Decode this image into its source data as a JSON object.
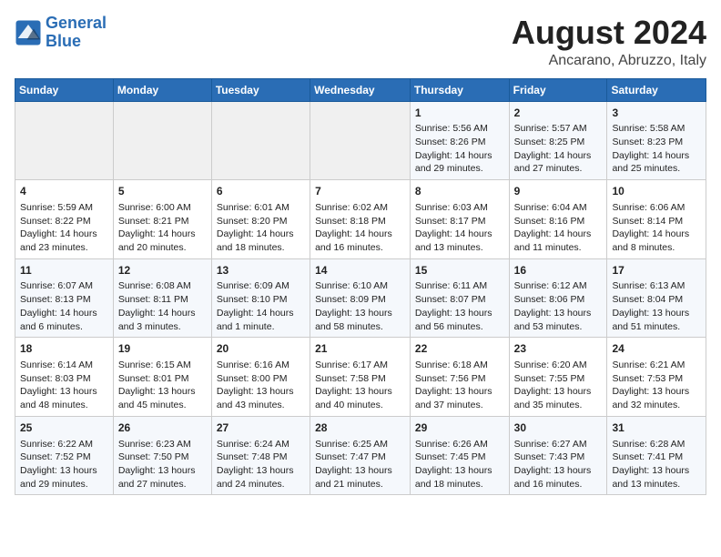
{
  "logo": {
    "line1": "General",
    "line2": "Blue"
  },
  "title": "August 2024",
  "location": "Ancarano, Abruzzo, Italy",
  "days_of_week": [
    "Sunday",
    "Monday",
    "Tuesday",
    "Wednesday",
    "Thursday",
    "Friday",
    "Saturday"
  ],
  "weeks": [
    [
      {
        "day": "",
        "detail": ""
      },
      {
        "day": "",
        "detail": ""
      },
      {
        "day": "",
        "detail": ""
      },
      {
        "day": "",
        "detail": ""
      },
      {
        "day": "1",
        "detail": "Sunrise: 5:56 AM\nSunset: 8:26 PM\nDaylight: 14 hours\nand 29 minutes."
      },
      {
        "day": "2",
        "detail": "Sunrise: 5:57 AM\nSunset: 8:25 PM\nDaylight: 14 hours\nand 27 minutes."
      },
      {
        "day": "3",
        "detail": "Sunrise: 5:58 AM\nSunset: 8:23 PM\nDaylight: 14 hours\nand 25 minutes."
      }
    ],
    [
      {
        "day": "4",
        "detail": "Sunrise: 5:59 AM\nSunset: 8:22 PM\nDaylight: 14 hours\nand 23 minutes."
      },
      {
        "day": "5",
        "detail": "Sunrise: 6:00 AM\nSunset: 8:21 PM\nDaylight: 14 hours\nand 20 minutes."
      },
      {
        "day": "6",
        "detail": "Sunrise: 6:01 AM\nSunset: 8:20 PM\nDaylight: 14 hours\nand 18 minutes."
      },
      {
        "day": "7",
        "detail": "Sunrise: 6:02 AM\nSunset: 8:18 PM\nDaylight: 14 hours\nand 16 minutes."
      },
      {
        "day": "8",
        "detail": "Sunrise: 6:03 AM\nSunset: 8:17 PM\nDaylight: 14 hours\nand 13 minutes."
      },
      {
        "day": "9",
        "detail": "Sunrise: 6:04 AM\nSunset: 8:16 PM\nDaylight: 14 hours\nand 11 minutes."
      },
      {
        "day": "10",
        "detail": "Sunrise: 6:06 AM\nSunset: 8:14 PM\nDaylight: 14 hours\nand 8 minutes."
      }
    ],
    [
      {
        "day": "11",
        "detail": "Sunrise: 6:07 AM\nSunset: 8:13 PM\nDaylight: 14 hours\nand 6 minutes."
      },
      {
        "day": "12",
        "detail": "Sunrise: 6:08 AM\nSunset: 8:11 PM\nDaylight: 14 hours\nand 3 minutes."
      },
      {
        "day": "13",
        "detail": "Sunrise: 6:09 AM\nSunset: 8:10 PM\nDaylight: 14 hours\nand 1 minute."
      },
      {
        "day": "14",
        "detail": "Sunrise: 6:10 AM\nSunset: 8:09 PM\nDaylight: 13 hours\nand 58 minutes."
      },
      {
        "day": "15",
        "detail": "Sunrise: 6:11 AM\nSunset: 8:07 PM\nDaylight: 13 hours\nand 56 minutes."
      },
      {
        "day": "16",
        "detail": "Sunrise: 6:12 AM\nSunset: 8:06 PM\nDaylight: 13 hours\nand 53 minutes."
      },
      {
        "day": "17",
        "detail": "Sunrise: 6:13 AM\nSunset: 8:04 PM\nDaylight: 13 hours\nand 51 minutes."
      }
    ],
    [
      {
        "day": "18",
        "detail": "Sunrise: 6:14 AM\nSunset: 8:03 PM\nDaylight: 13 hours\nand 48 minutes."
      },
      {
        "day": "19",
        "detail": "Sunrise: 6:15 AM\nSunset: 8:01 PM\nDaylight: 13 hours\nand 45 minutes."
      },
      {
        "day": "20",
        "detail": "Sunrise: 6:16 AM\nSunset: 8:00 PM\nDaylight: 13 hours\nand 43 minutes."
      },
      {
        "day": "21",
        "detail": "Sunrise: 6:17 AM\nSunset: 7:58 PM\nDaylight: 13 hours\nand 40 minutes."
      },
      {
        "day": "22",
        "detail": "Sunrise: 6:18 AM\nSunset: 7:56 PM\nDaylight: 13 hours\nand 37 minutes."
      },
      {
        "day": "23",
        "detail": "Sunrise: 6:20 AM\nSunset: 7:55 PM\nDaylight: 13 hours\nand 35 minutes."
      },
      {
        "day": "24",
        "detail": "Sunrise: 6:21 AM\nSunset: 7:53 PM\nDaylight: 13 hours\nand 32 minutes."
      }
    ],
    [
      {
        "day": "25",
        "detail": "Sunrise: 6:22 AM\nSunset: 7:52 PM\nDaylight: 13 hours\nand 29 minutes."
      },
      {
        "day": "26",
        "detail": "Sunrise: 6:23 AM\nSunset: 7:50 PM\nDaylight: 13 hours\nand 27 minutes."
      },
      {
        "day": "27",
        "detail": "Sunrise: 6:24 AM\nSunset: 7:48 PM\nDaylight: 13 hours\nand 24 minutes."
      },
      {
        "day": "28",
        "detail": "Sunrise: 6:25 AM\nSunset: 7:47 PM\nDaylight: 13 hours\nand 21 minutes."
      },
      {
        "day": "29",
        "detail": "Sunrise: 6:26 AM\nSunset: 7:45 PM\nDaylight: 13 hours\nand 18 minutes."
      },
      {
        "day": "30",
        "detail": "Sunrise: 6:27 AM\nSunset: 7:43 PM\nDaylight: 13 hours\nand 16 minutes."
      },
      {
        "day": "31",
        "detail": "Sunrise: 6:28 AM\nSunset: 7:41 PM\nDaylight: 13 hours\nand 13 minutes."
      }
    ]
  ]
}
